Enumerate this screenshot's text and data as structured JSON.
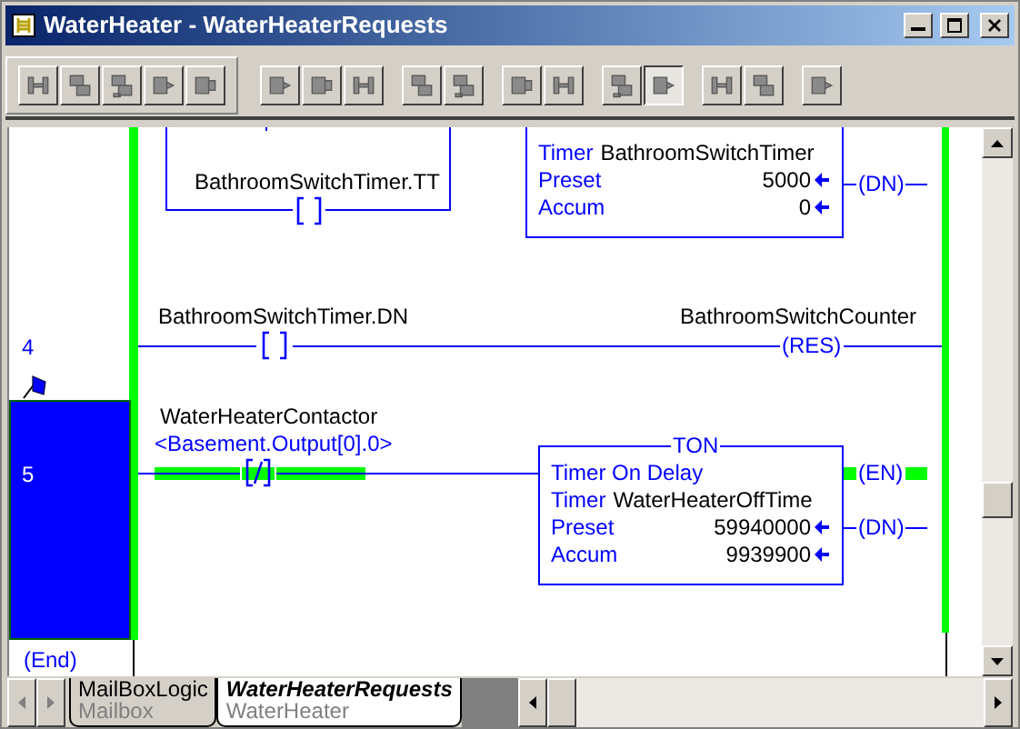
{
  "window": {
    "title": "WaterHeater - WaterHeaterRequests"
  },
  "toolbar": {
    "groups": [
      {
        "buttons": [
          {
            "pressed": false
          },
          {
            "pressed": false
          },
          {
            "pressed": false
          },
          {
            "pressed": false
          },
          {
            "pressed": false
          }
        ]
      },
      {
        "buttons": [
          {
            "pressed": false
          },
          {
            "pressed": false
          },
          {
            "pressed": false
          }
        ]
      },
      {
        "buttons": [
          {
            "pressed": false
          },
          {
            "pressed": false
          }
        ]
      },
      {
        "buttons": [
          {
            "pressed": false
          },
          {
            "pressed": false
          }
        ]
      },
      {
        "buttons": [
          {
            "pressed": false
          },
          {
            "pressed": true
          }
        ]
      },
      {
        "buttons": [
          {
            "pressed": false
          },
          {
            "pressed": false
          }
        ]
      },
      {
        "buttons": [
          {
            "pressed": false
          }
        ]
      }
    ]
  },
  "ladder": {
    "rungs": [
      {
        "kind": "timer_branch",
        "contact": {
          "tag": "BathroomSwitchTimer.TT",
          "kind": "xic",
          "energized": false
        },
        "timer": {
          "rows": [
            {
              "label": "Timer",
              "value": "BathroomSwitchTimer",
              "arrow": false
            },
            {
              "label": "Preset",
              "value": "5000",
              "arrow": true
            },
            {
              "label": "Accum",
              "value": "0",
              "arrow": true
            }
          ]
        },
        "outputs": [
          {
            "label": "(DN)",
            "energized": false
          }
        ]
      },
      {
        "kind": "coil",
        "number": "4",
        "selected": false,
        "contact": {
          "tag": "BathroomSwitchTimer.DN",
          "kind": "xic",
          "energized": false
        },
        "coil": {
          "tag": "BathroomSwitchCounter",
          "label": "(RES)"
        }
      },
      {
        "kind": "ton",
        "number": "5",
        "selected": true,
        "contact": {
          "tag": "WaterHeaterContactor",
          "alias": "<Basement.Output[0].0>",
          "kind": "xio",
          "energized": true
        },
        "timer": {
          "title": "TON",
          "description": "Timer On Delay",
          "rows": [
            {
              "label": "Timer",
              "value": "WaterHeaterOffTime",
              "arrow": false
            },
            {
              "label": "Preset",
              "value": "59940000",
              "arrow": true
            },
            {
              "label": "Accum",
              "value": "9939900",
              "arrow": true
            }
          ]
        },
        "outputs": [
          {
            "label": "(EN)",
            "energized": true
          },
          {
            "label": "(DN)",
            "energized": false
          }
        ]
      }
    ],
    "end_label": "(End)"
  },
  "tabs": [
    {
      "title": "MailBoxLogic",
      "subtitle": "Mailbox",
      "selected": false
    },
    {
      "title": "WaterHeaterRequests",
      "subtitle": "WaterHeater",
      "selected": true
    }
  ]
}
